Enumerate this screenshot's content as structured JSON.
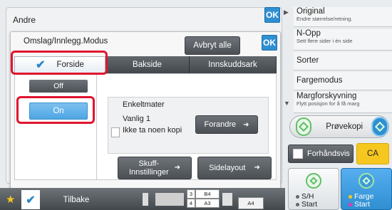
{
  "outer": {
    "title": "Andre",
    "ok_label": "OK"
  },
  "dialog": {
    "title": "Omslag/Innlegg.Modus",
    "cancel_all": "Avbryt alle",
    "ok_label": "OK",
    "tabs": [
      {
        "label": "Forside",
        "active": true
      },
      {
        "label": "Bakside",
        "active": false
      },
      {
        "label": "Innskuddsark",
        "active": false
      }
    ],
    "off_label": "Off",
    "on_label": "On",
    "info": {
      "feed": "Enkeltmater",
      "tray": "Vanlig 1",
      "copy": "Ikke ta noen kopi",
      "change_button": "Forandre"
    },
    "bottom": {
      "tray_settings_line1": "Skuff-",
      "tray_settings_line2": "Innstillinger",
      "page_layout": "Sidelayout"
    }
  },
  "right_panel": {
    "items": [
      {
        "title": "Original",
        "subtitle": "Endre størrelse/retning."
      },
      {
        "title": "N-Opp",
        "subtitle": "Sett flere sider i én side"
      },
      {
        "title": "Sorter",
        "subtitle": ""
      },
      {
        "title": "Fargemodus",
        "subtitle": ""
      },
      {
        "title": "Margforskyvning",
        "subtitle": "Flytt posisjon for å få marg"
      }
    ],
    "preview_copy": "Prøvekopi",
    "preview": "Forhåndsvis",
    "ca": "CA",
    "start_bw_line1": "S/H",
    "start_bw_line2": "Start",
    "start_color_line1": "Farge",
    "start_color_line2": "Start"
  },
  "statusbar": {
    "back": "Tilbake",
    "trays": [
      {
        "num": "3",
        "size": "B4"
      },
      {
        "num": "4",
        "size": "A3"
      }
    ],
    "current_size": "A4"
  },
  "colors": {
    "accent_blue": "#2f8fd1",
    "highlight_red": "#e0152e",
    "ca_yellow": "#f6c71f",
    "start_green": "#5fbf64"
  }
}
